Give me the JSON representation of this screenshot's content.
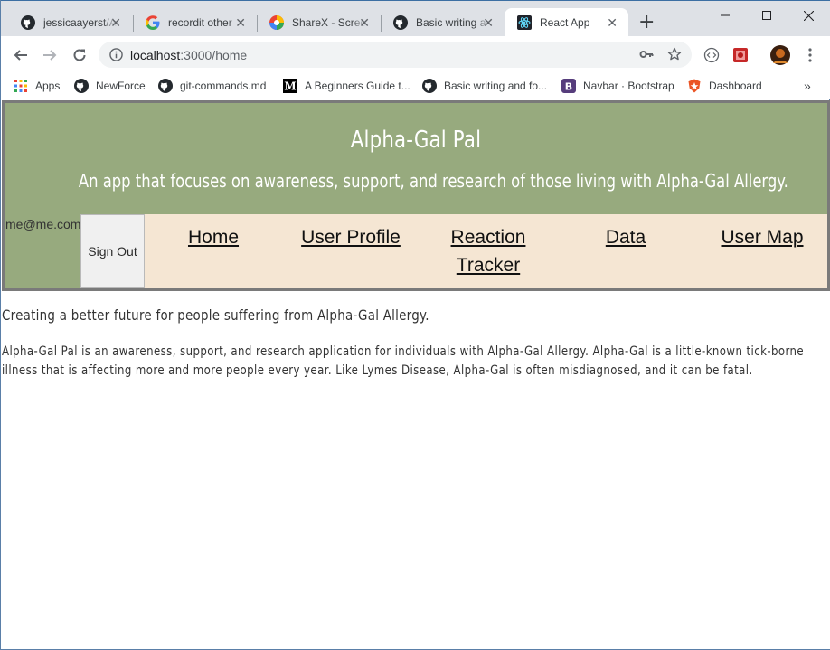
{
  "browser": {
    "tabs": [
      {
        "title": "jessicaayerst/A",
        "icon": "github-icon",
        "active": false
      },
      {
        "title": "recordit other",
        "icon": "google-icon",
        "active": false
      },
      {
        "title": "ShareX - Scree",
        "icon": "sharex-icon",
        "active": false
      },
      {
        "title": "Basic writing a",
        "icon": "github-icon",
        "active": false
      },
      {
        "title": "React App",
        "icon": "react-icon",
        "active": true
      }
    ],
    "url_host": "localhost",
    "url_path": ":3000/home",
    "bookmarks": [
      {
        "label": "Apps",
        "icon": "apps-grid-icon"
      },
      {
        "label": "NewForce",
        "icon": "github-icon"
      },
      {
        "label": "git-commands.md",
        "icon": "github-icon"
      },
      {
        "label": "A Beginners Guide t...",
        "icon": "medium-icon"
      },
      {
        "label": "Basic writing and fo...",
        "icon": "github-icon"
      },
      {
        "label": "Navbar · Bootstrap",
        "icon": "bootstrap-icon"
      },
      {
        "label": "Dashboard",
        "icon": "auth0-icon"
      }
    ],
    "overflow_label": "»"
  },
  "app": {
    "title": "Alpha-Gal Pal",
    "subtitle": "An app that focuses on awareness, support, and research of those living with Alpha-Gal Allergy.",
    "user_email": "me@me.com",
    "signout_label": "Sign Out",
    "nav": [
      {
        "label": "Home"
      },
      {
        "label": "User Profile"
      },
      {
        "label": "Reaction Tracker"
      },
      {
        "label": "Data"
      },
      {
        "label": "User Map"
      }
    ]
  },
  "content": {
    "tagline": "Creating a better future for people suffering from Alpha-Gal Allergy.",
    "description": "Alpha-Gal Pal is an awareness, support, and research application for individuals with Alpha-Gal Allergy. Alpha-Gal is a little-known tick-borne illness that is affecting more and more people every year. Like Lymes Disease, Alpha-Gal is often misdiagnosed, and it can be fatal."
  },
  "colors": {
    "header_bg": "#97aa7e",
    "nav_bg": "#f5e6d3",
    "header_border": "#7a7a7a"
  }
}
